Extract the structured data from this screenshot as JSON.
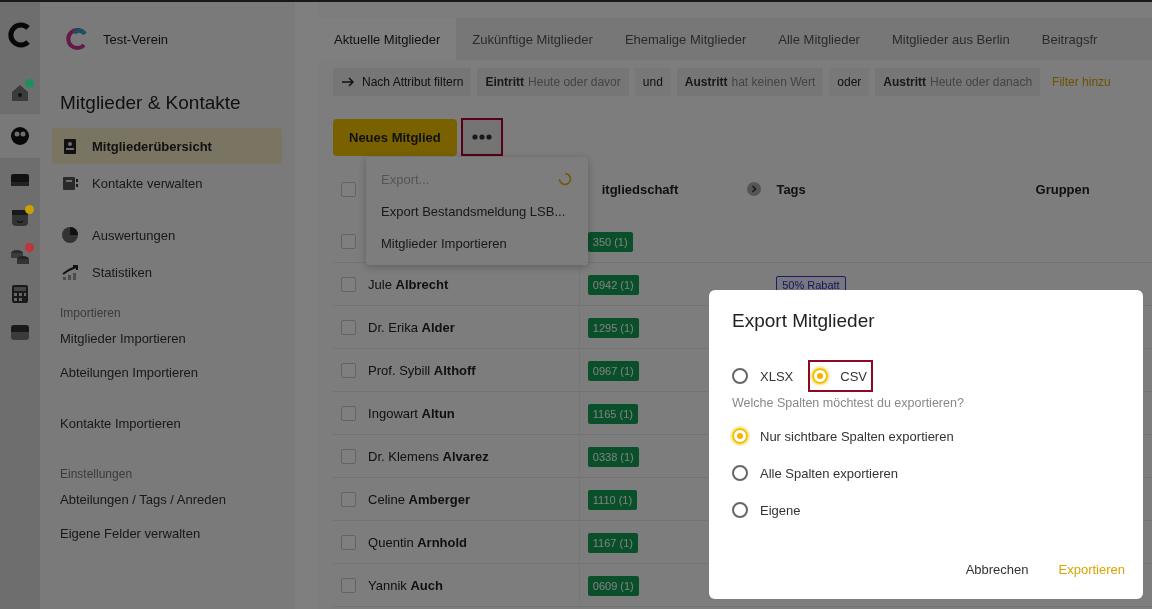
{
  "rail": {
    "items": [
      {
        "selected": false,
        "color": "#1f8f5a"
      },
      {
        "selected": true
      },
      {
        "selected": false
      },
      {
        "selected": false,
        "color": "#c9a000"
      },
      {
        "selected": false,
        "color": "#c0343a"
      },
      {
        "selected": false
      },
      {
        "selected": false
      }
    ]
  },
  "sidebar": {
    "club_name": "Test-Verein",
    "title": "Mitglieder & Kontakte",
    "nav": [
      {
        "label": "Mitgliederübersicht",
        "selected": true
      },
      {
        "label": "Kontakte verwalten",
        "selected": false
      }
    ],
    "nav_secondary": [
      {
        "label": "Auswertungen",
        "selected": false
      },
      {
        "label": "Statistiken",
        "selected": false
      }
    ],
    "sections": [
      {
        "heading": "Importieren",
        "groups": [
          {
            "items": [
              "Mitglieder Importieren",
              "Abteilungen Importieren"
            ]
          },
          {
            "items": [
              "Kontakte Importieren"
            ]
          }
        ]
      },
      {
        "heading": "Einstellungen",
        "groups": [
          {
            "items": [
              "Abteilungen / Tags / Anreden",
              "Eigene Felder verwalten"
            ]
          }
        ]
      }
    ]
  },
  "tabs": [
    {
      "label": "Aktuelle Mitglieder",
      "selected": true
    },
    {
      "label": "Zukünftige Mitglieder",
      "selected": false
    },
    {
      "label": "Ehemalige Mitglieder",
      "selected": false
    },
    {
      "label": "Alle Mitglieder",
      "selected": false
    },
    {
      "label": "Mitglieder aus Berlin",
      "selected": false
    },
    {
      "label": "Beitragsfr",
      "selected": false
    }
  ],
  "filters": [
    {
      "kind": "button",
      "label": "Nach Attribut filtern"
    },
    {
      "kind": "condition",
      "attribute": "Eintritt",
      "value": "Heute oder davor"
    },
    {
      "kind": "operator",
      "label": "und"
    },
    {
      "kind": "condition",
      "attribute": "Austritt",
      "value": "hat keinen Wert"
    },
    {
      "kind": "operator",
      "label": "oder"
    },
    {
      "kind": "condition",
      "attribute": "Austritt",
      "value": "Heute oder danach"
    },
    {
      "kind": "add",
      "label": "Filter hinzu"
    }
  ],
  "toolbar": {
    "new_button": "Neues Mitglied",
    "more_button": {
      "highlighted": true
    }
  },
  "more_menu": {
    "items": [
      {
        "label": "Export...",
        "disabled": true,
        "loading": true
      },
      {
        "label": "Export Bestandsmeldung LSB...",
        "disabled": false,
        "loading": false
      },
      {
        "label": "Mitglieder Importieren",
        "disabled": false,
        "loading": false
      }
    ]
  },
  "table": {
    "all_checked": false,
    "columns": [
      "itgliedschaft",
      "Tags",
      "Gruppen"
    ],
    "rows": [
      {
        "checked": false,
        "membership": "350 (1)"
      },
      {
        "checked": false,
        "name": "Jule **Albrecht**",
        "membership": "0942 (1)",
        "tags": [
          "50% Rabatt"
        ]
      },
      {
        "checked": false,
        "name": "Dr. Erika **Alder**",
        "membership": "1295 (1)"
      },
      {
        "checked": false,
        "name": "Prof. Sybill **Althoff**",
        "membership": "0967 (1)"
      },
      {
        "checked": false,
        "name": "Ingowart **Altun**",
        "membership": "1165 (1)"
      },
      {
        "checked": false,
        "name": "Dr. Klemens **Alvarez**",
        "membership": "0338 (1)"
      },
      {
        "checked": false,
        "name": "Celine **Amberger**",
        "membership": "1110 (1)"
      },
      {
        "checked": false,
        "name": "Quentin **Arnhold**",
        "membership": "1167 (1)"
      },
      {
        "checked": false,
        "name": "Yannik **Auch**",
        "membership": "0609 (1)"
      }
    ]
  },
  "dialog": {
    "title": "Export Mitglieder",
    "formats": [
      {
        "label": "XLSX",
        "selected": false,
        "highlighted": false
      },
      {
        "label": "CSV",
        "selected": true,
        "highlighted": true
      }
    ],
    "question": "Welche Spalten möchtest du exportieren?",
    "column_options": [
      {
        "label": "Nur sichtbare Spalten exportieren",
        "selected": true
      },
      {
        "label": "Alle Spalten exportieren",
        "selected": false
      },
      {
        "label": "Eigene",
        "selected": false
      }
    ],
    "buttons": [
      {
        "kind": "secondary",
        "label": "Abbrechen"
      },
      {
        "kind": "primary",
        "label": "Exportieren"
      }
    ]
  }
}
